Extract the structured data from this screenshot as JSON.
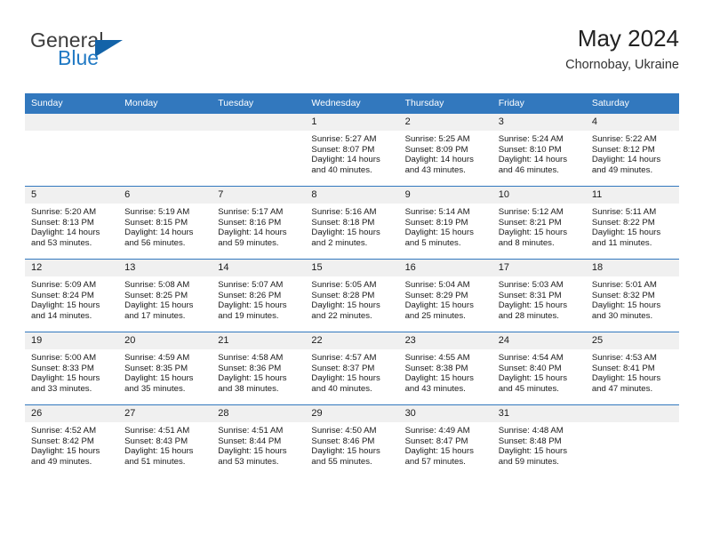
{
  "brand": {
    "word_one": "General",
    "word_two": "Blue",
    "triangle_icon": "blue-triangle-logo-icon",
    "accent_color": "#1363a8"
  },
  "header": {
    "title": "May 2024",
    "subtitle": "Chornobay, Ukraine"
  },
  "theme": {
    "header_row_bg": "#3278be",
    "date_band_bg": "#f0f0f0",
    "grid_line": "#3278be",
    "brand_blue": "#2079c4"
  },
  "calendar": {
    "weekday_headers": [
      "Sunday",
      "Monday",
      "Tuesday",
      "Wednesday",
      "Thursday",
      "Friday",
      "Saturday"
    ],
    "weeks": [
      [
        {
          "day": "",
          "empty": true
        },
        {
          "day": "",
          "empty": true
        },
        {
          "day": "",
          "empty": true
        },
        {
          "day": "1",
          "sunrise": "Sunrise: 5:27 AM",
          "sunset": "Sunset: 8:07 PM",
          "daylight_1": "Daylight: 14 hours",
          "daylight_2": "and 40 minutes."
        },
        {
          "day": "2",
          "sunrise": "Sunrise: 5:25 AM",
          "sunset": "Sunset: 8:09 PM",
          "daylight_1": "Daylight: 14 hours",
          "daylight_2": "and 43 minutes."
        },
        {
          "day": "3",
          "sunrise": "Sunrise: 5:24 AM",
          "sunset": "Sunset: 8:10 PM",
          "daylight_1": "Daylight: 14 hours",
          "daylight_2": "and 46 minutes."
        },
        {
          "day": "4",
          "sunrise": "Sunrise: 5:22 AM",
          "sunset": "Sunset: 8:12 PM",
          "daylight_1": "Daylight: 14 hours",
          "daylight_2": "and 49 minutes."
        }
      ],
      [
        {
          "day": "5",
          "sunrise": "Sunrise: 5:20 AM",
          "sunset": "Sunset: 8:13 PM",
          "daylight_1": "Daylight: 14 hours",
          "daylight_2": "and 53 minutes."
        },
        {
          "day": "6",
          "sunrise": "Sunrise: 5:19 AM",
          "sunset": "Sunset: 8:15 PM",
          "daylight_1": "Daylight: 14 hours",
          "daylight_2": "and 56 minutes."
        },
        {
          "day": "7",
          "sunrise": "Sunrise: 5:17 AM",
          "sunset": "Sunset: 8:16 PM",
          "daylight_1": "Daylight: 14 hours",
          "daylight_2": "and 59 minutes."
        },
        {
          "day": "8",
          "sunrise": "Sunrise: 5:16 AM",
          "sunset": "Sunset: 8:18 PM",
          "daylight_1": "Daylight: 15 hours",
          "daylight_2": "and 2 minutes."
        },
        {
          "day": "9",
          "sunrise": "Sunrise: 5:14 AM",
          "sunset": "Sunset: 8:19 PM",
          "daylight_1": "Daylight: 15 hours",
          "daylight_2": "and 5 minutes."
        },
        {
          "day": "10",
          "sunrise": "Sunrise: 5:12 AM",
          "sunset": "Sunset: 8:21 PM",
          "daylight_1": "Daylight: 15 hours",
          "daylight_2": "and 8 minutes."
        },
        {
          "day": "11",
          "sunrise": "Sunrise: 5:11 AM",
          "sunset": "Sunset: 8:22 PM",
          "daylight_1": "Daylight: 15 hours",
          "daylight_2": "and 11 minutes."
        }
      ],
      [
        {
          "day": "12",
          "sunrise": "Sunrise: 5:09 AM",
          "sunset": "Sunset: 8:24 PM",
          "daylight_1": "Daylight: 15 hours",
          "daylight_2": "and 14 minutes."
        },
        {
          "day": "13",
          "sunrise": "Sunrise: 5:08 AM",
          "sunset": "Sunset: 8:25 PM",
          "daylight_1": "Daylight: 15 hours",
          "daylight_2": "and 17 minutes."
        },
        {
          "day": "14",
          "sunrise": "Sunrise: 5:07 AM",
          "sunset": "Sunset: 8:26 PM",
          "daylight_1": "Daylight: 15 hours",
          "daylight_2": "and 19 minutes."
        },
        {
          "day": "15",
          "sunrise": "Sunrise: 5:05 AM",
          "sunset": "Sunset: 8:28 PM",
          "daylight_1": "Daylight: 15 hours",
          "daylight_2": "and 22 minutes."
        },
        {
          "day": "16",
          "sunrise": "Sunrise: 5:04 AM",
          "sunset": "Sunset: 8:29 PM",
          "daylight_1": "Daylight: 15 hours",
          "daylight_2": "and 25 minutes."
        },
        {
          "day": "17",
          "sunrise": "Sunrise: 5:03 AM",
          "sunset": "Sunset: 8:31 PM",
          "daylight_1": "Daylight: 15 hours",
          "daylight_2": "and 28 minutes."
        },
        {
          "day": "18",
          "sunrise": "Sunrise: 5:01 AM",
          "sunset": "Sunset: 8:32 PM",
          "daylight_1": "Daylight: 15 hours",
          "daylight_2": "and 30 minutes."
        }
      ],
      [
        {
          "day": "19",
          "sunrise": "Sunrise: 5:00 AM",
          "sunset": "Sunset: 8:33 PM",
          "daylight_1": "Daylight: 15 hours",
          "daylight_2": "and 33 minutes."
        },
        {
          "day": "20",
          "sunrise": "Sunrise: 4:59 AM",
          "sunset": "Sunset: 8:35 PM",
          "daylight_1": "Daylight: 15 hours",
          "daylight_2": "and 35 minutes."
        },
        {
          "day": "21",
          "sunrise": "Sunrise: 4:58 AM",
          "sunset": "Sunset: 8:36 PM",
          "daylight_1": "Daylight: 15 hours",
          "daylight_2": "and 38 minutes."
        },
        {
          "day": "22",
          "sunrise": "Sunrise: 4:57 AM",
          "sunset": "Sunset: 8:37 PM",
          "daylight_1": "Daylight: 15 hours",
          "daylight_2": "and 40 minutes."
        },
        {
          "day": "23",
          "sunrise": "Sunrise: 4:55 AM",
          "sunset": "Sunset: 8:38 PM",
          "daylight_1": "Daylight: 15 hours",
          "daylight_2": "and 43 minutes."
        },
        {
          "day": "24",
          "sunrise": "Sunrise: 4:54 AM",
          "sunset": "Sunset: 8:40 PM",
          "daylight_1": "Daylight: 15 hours",
          "daylight_2": "and 45 minutes."
        },
        {
          "day": "25",
          "sunrise": "Sunrise: 4:53 AM",
          "sunset": "Sunset: 8:41 PM",
          "daylight_1": "Daylight: 15 hours",
          "daylight_2": "and 47 minutes."
        }
      ],
      [
        {
          "day": "26",
          "sunrise": "Sunrise: 4:52 AM",
          "sunset": "Sunset: 8:42 PM",
          "daylight_1": "Daylight: 15 hours",
          "daylight_2": "and 49 minutes."
        },
        {
          "day": "27",
          "sunrise": "Sunrise: 4:51 AM",
          "sunset": "Sunset: 8:43 PM",
          "daylight_1": "Daylight: 15 hours",
          "daylight_2": "and 51 minutes."
        },
        {
          "day": "28",
          "sunrise": "Sunrise: 4:51 AM",
          "sunset": "Sunset: 8:44 PM",
          "daylight_1": "Daylight: 15 hours",
          "daylight_2": "and 53 minutes."
        },
        {
          "day": "29",
          "sunrise": "Sunrise: 4:50 AM",
          "sunset": "Sunset: 8:46 PM",
          "daylight_1": "Daylight: 15 hours",
          "daylight_2": "and 55 minutes."
        },
        {
          "day": "30",
          "sunrise": "Sunrise: 4:49 AM",
          "sunset": "Sunset: 8:47 PM",
          "daylight_1": "Daylight: 15 hours",
          "daylight_2": "and 57 minutes."
        },
        {
          "day": "31",
          "sunrise": "Sunrise: 4:48 AM",
          "sunset": "Sunset: 8:48 PM",
          "daylight_1": "Daylight: 15 hours",
          "daylight_2": "and 59 minutes."
        },
        {
          "day": "",
          "empty": true
        }
      ]
    ]
  }
}
